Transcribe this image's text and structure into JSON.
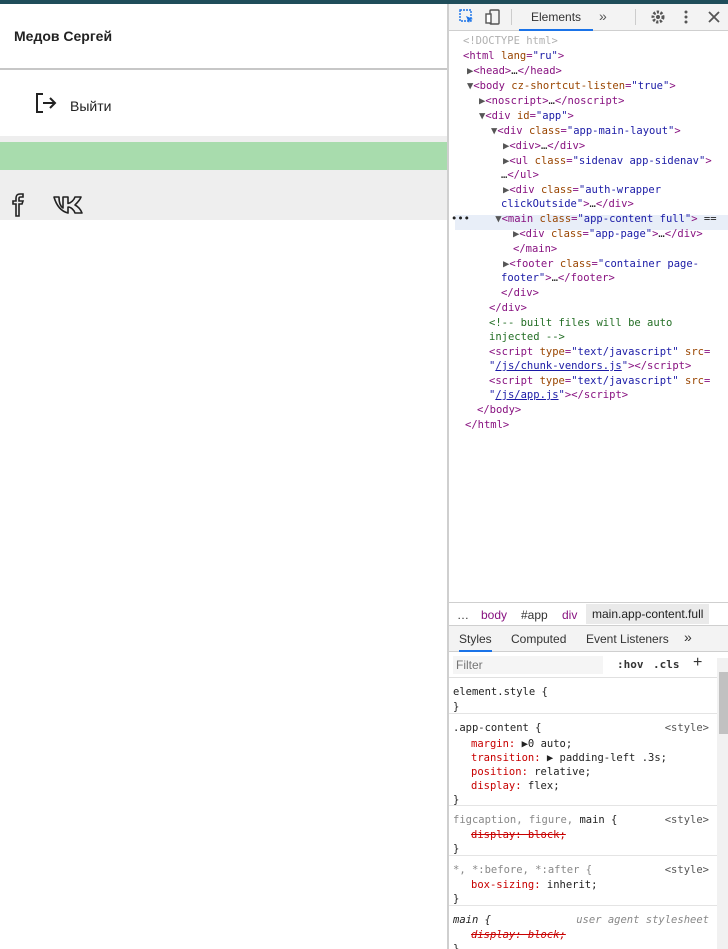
{
  "page": {
    "user_name": "Медов Сергей",
    "logout_label": "Выйти"
  },
  "devtools": {
    "active_tab": "Elements",
    "more_tabs": "»",
    "dom": {
      "doctype": "<!DOCTYPE html>",
      "lines": [
        "built files will be auto",
        "injected -->"
      ],
      "script1_src": "/js/chunk-vendors.js",
      "script2_src": "/js/app.js"
    },
    "breadcrumbs": [
      "…",
      "body",
      "#app",
      "div",
      "main.app-content.full"
    ],
    "styles_tabs": [
      "Styles",
      "Computed",
      "Event Listeners",
      "»"
    ],
    "filter_placeholder": "Filter",
    "hov": ":hov",
    "cls": ".cls",
    "plus": "+",
    "rules": {
      "element_style": "element.style {",
      "app_content_selector": ".app-content {",
      "style_source": "<style>",
      "margin_prop": "margin:",
      "margin_val": "0 auto;",
      "transition_prop": "transition:",
      "transition_val": "padding-left .3s;",
      "position_prop": "position:",
      "position_val": "relative;",
      "display_prop": "display:",
      "display_val": "flex;",
      "fig_selector_gray": "figcaption, figure, ",
      "fig_selector_main": "main",
      "fig_selector_end": " {",
      "display_block": "display: block;",
      "universal_selector": "*, *:before, *:after {",
      "box_sizing_prop": "box-sizing:",
      "box_sizing_val": "inherit;",
      "main_selector": "main",
      "main_brace": " {",
      "ua_source": "user agent stylesheet",
      "close": "}"
    }
  },
  "colors": {
    "green_bar": "#a8dcad",
    "accent": "#1a73e8",
    "top_bar": "#1f4d5a"
  }
}
